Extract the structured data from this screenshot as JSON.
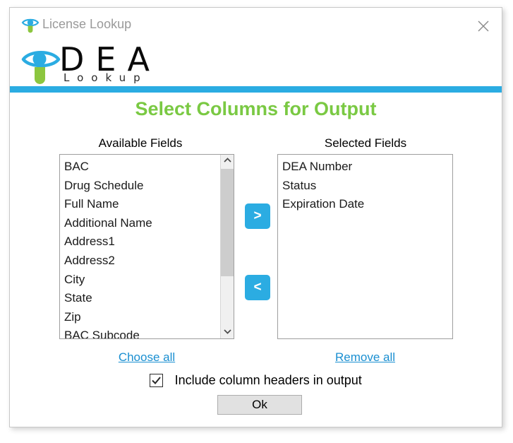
{
  "window": {
    "title": "License Lookup",
    "close_label": "×"
  },
  "logo": {
    "brand": "DEA",
    "sub": "Lookup"
  },
  "heading": "Select Columns for Output",
  "labels": {
    "available": "Available Fields",
    "selected": "Selected Fields"
  },
  "available_fields": [
    "BAC",
    "Drug Schedule",
    "Full Name",
    "Additional Name",
    "Address1",
    "Address2",
    "City",
    "State",
    "Zip",
    "BAC Subcode"
  ],
  "selected_fields": [
    "DEA Number",
    "Status",
    "Expiration Date"
  ],
  "buttons": {
    "move_right": ">",
    "move_left": "<",
    "ok": "Ok"
  },
  "links": {
    "choose_all": "Choose all",
    "remove_all": "Remove all"
  },
  "checkbox": {
    "label": "Include column headers in output",
    "checked": true
  },
  "colors": {
    "accent_blue": "#2bace2",
    "heading_green": "#7ac943",
    "link_blue": "#1a8fd1",
    "logo_green": "#8cc63f"
  }
}
